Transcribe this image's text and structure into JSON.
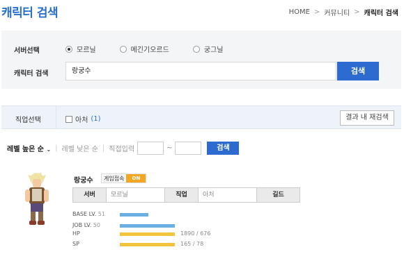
{
  "header": {
    "title": "캐릭터 검색",
    "breadcrumb": [
      "HOME",
      "커뮤니티",
      "캐릭터 검색"
    ]
  },
  "search": {
    "server_label": "서버선택",
    "servers": [
      {
        "label": "모르닐",
        "selected": true
      },
      {
        "label": "메긴기오르드",
        "selected": false
      },
      {
        "label": "궁그닐",
        "selected": false
      }
    ],
    "character_label": "캐릭터 검색",
    "character_value": "랑궁수",
    "search_button": "검색"
  },
  "job_filter": {
    "label": "직업선택",
    "option_label": "아처",
    "option_count": "(1)",
    "refine_button": "결과 내 재검색"
  },
  "sort": {
    "level_high": "레벨 높은 순",
    "level_low": "레벨 낮은 순",
    "level_input_label": "직접입력",
    "tilde": "~",
    "search_button": "검색"
  },
  "result": {
    "name": "랑궁수",
    "status_label": "게임접속",
    "status_value": "ON",
    "server_header": "서버",
    "server_value": "모르닐",
    "job_header": "직업",
    "job_value": "아처",
    "guild_header": "길드",
    "guild_value": "",
    "stats": [
      {
        "label": "BASE LV.",
        "value": "51",
        "fill": 0.52,
        "color": "#6aaee4",
        "text": ""
      },
      {
        "label": "JOB LV.",
        "value": "50",
        "fill": 1.0,
        "color": "#6aaee4",
        "text": ""
      },
      {
        "label": "HP",
        "value": "",
        "fill": 1.0,
        "color": "#f2c43d",
        "text": "1890 / 676"
      },
      {
        "label": "SP",
        "value": "",
        "fill": 1.0,
        "color": "#f2c43d",
        "text": "165 / 78"
      }
    ]
  }
}
